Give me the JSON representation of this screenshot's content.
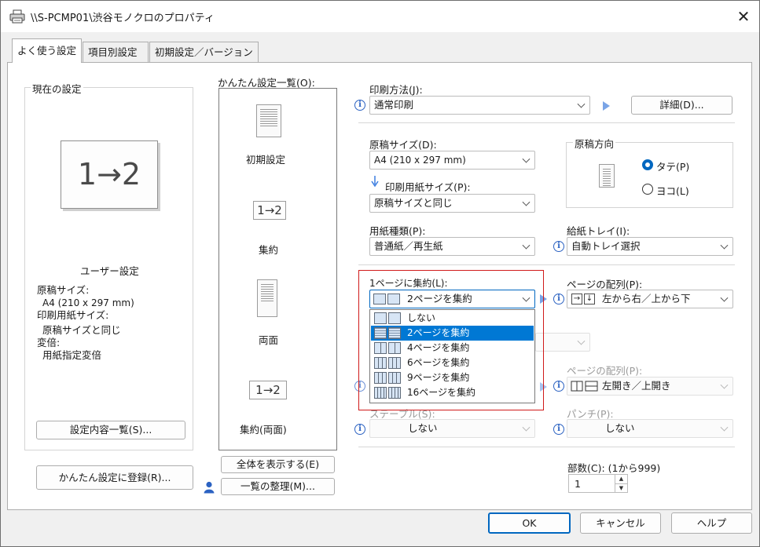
{
  "window": {
    "title": "\\\\S-PCMP01\\渋谷モノクロのプロパティ",
    "close_symbol": "✕"
  },
  "tabs": [
    "よく使う設定",
    "項目別設定",
    "初期設定／バージョン"
  ],
  "current_settings": {
    "group_label": "現在の設定",
    "preview_text": "1→2",
    "user_label": "ユーザー設定",
    "details": [
      "原稿サイズ:",
      "A4 (210 x 297 mm)",
      "印刷用紙サイズ:",
      "原稿サイズと同じ",
      "変倍:",
      "用紙指定変倍"
    ],
    "list_button": "設定内容一覧(S)...",
    "register_button": "かんたん設定に登録(R)..."
  },
  "easy_settings": {
    "label": "かんたん設定一覧(O):",
    "items": [
      {
        "label": "初期設定",
        "icon": "document-icon",
        "icon_text": ""
      },
      {
        "label": "集約",
        "icon": "nup-icon",
        "icon_text": "1→2"
      },
      {
        "label": "両面",
        "icon": "duplex-icon",
        "icon_text": ""
      },
      {
        "label": "集約(両面)",
        "icon": "nup-duplex-icon",
        "icon_text": "1→2"
      }
    ],
    "show_all_button": "全体を表示する(E)",
    "organize_button": "一覧の整理(M)..."
  },
  "print": {
    "method_label": "印刷方法(J):",
    "method_value": "通常印刷",
    "details_button": "詳細(D)...",
    "original_size_label": "原稿サイズ(D):",
    "original_size_value": "A4 (210 x 297 mm)",
    "paper_size_label": "印刷用紙サイズ(P):",
    "paper_size_value": "原稿サイズと同じ",
    "orientation": {
      "label": "原稿方向",
      "portrait": "タテ(P)",
      "landscape": "ヨコ(L)",
      "selected": "portrait"
    },
    "paper_type_label": "用紙種類(P):",
    "paper_type_value": "普通紙／再生紙",
    "tray_label": "給紙トレイ(I):",
    "tray_value": "自動トレイ選択",
    "nup_label": "1ページに集約(L):",
    "nup_value": "2ページを集約",
    "nup_options": [
      "しない",
      "2ページを集約",
      "4ページを集約",
      "6ページを集約",
      "9ページを集約",
      "16ページを集約"
    ],
    "nup_selected_index": 1,
    "page_order_label": "ページの配列(P):",
    "page_order_value": "左から右／上から下",
    "binding_order_label": "ページの配列(P):",
    "binding_order_value": "左開き／上開き",
    "staple_label": "ステープル(S):",
    "staple_value": "しない",
    "punch_label": "パンチ(P):",
    "punch_value": "しない",
    "copies_label": "部数(C): (1から999)",
    "copies_value": "1"
  },
  "footer": {
    "ok": "OK",
    "cancel": "キャンセル",
    "help": "ヘルプ"
  },
  "colors": {
    "accent": "#0067c0",
    "selection": "#0078d4",
    "highlight_box": "#d01a1a",
    "info_icon": "#2b62c2"
  }
}
